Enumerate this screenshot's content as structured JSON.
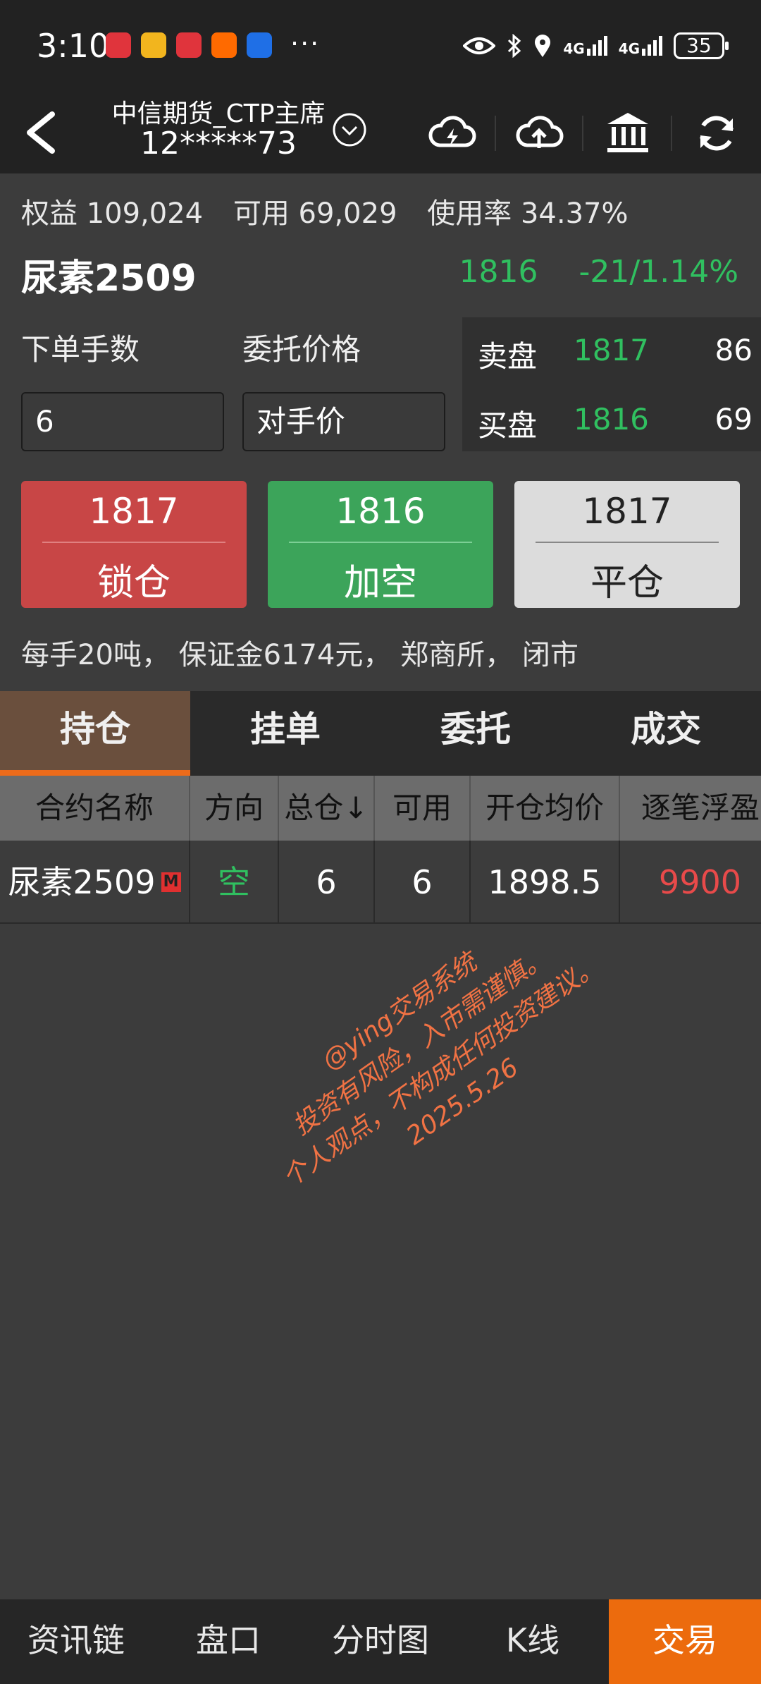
{
  "status_bar": {
    "time": "3:10",
    "apps": [
      "huawei-store-icon",
      "weibo-icon",
      "huawei-icon",
      "taobao-icon",
      "bulb-icon"
    ],
    "more": "···",
    "signal1": "4G",
    "signal2": "4G",
    "battery": "35"
  },
  "header": {
    "broker": "中信期货_CTP主席",
    "account": "12*****73",
    "icons": [
      "cloud-lightning-icon",
      "cloud-upload-icon",
      "bank-icon",
      "refresh-icon"
    ]
  },
  "account_summary": {
    "equity": "权益 109,024",
    "available": "可用 69,029",
    "usage": "使用率 34.37%"
  },
  "contract": {
    "name": "尿素2509",
    "last_price": "1816",
    "change": "-21/1.14%"
  },
  "order_form": {
    "lots_label": "下单手数",
    "price_label": "委托价格",
    "lots_value": "6",
    "price_value": "对手价"
  },
  "order_book": {
    "ask_label": "卖盘",
    "ask_price": "1817",
    "ask_volume": "86",
    "bid_label": "买盘",
    "bid_price": "1816",
    "bid_volume": "69"
  },
  "trade_buttons": {
    "lock": {
      "price": "1817",
      "label": "锁仓"
    },
    "add_short": {
      "price": "1816",
      "label": "加空"
    },
    "close": {
      "price": "1817",
      "label": "平仓"
    }
  },
  "contract_info": "每手20吨， 保证金6174元， 郑商所， 闭市",
  "tabs": [
    "持仓",
    "挂单",
    "委托",
    "成交"
  ],
  "positions": {
    "headers": [
      "合约名称",
      "方向",
      "总仓↓",
      "可用",
      "开仓均价",
      "逐笔浮盈"
    ],
    "rows": [
      {
        "name": "尿素2509",
        "badge": "M",
        "direction": "空",
        "total": "6",
        "available": "6",
        "avg_price": "1898.5",
        "pnl": "9900"
      }
    ]
  },
  "watermark": {
    "line1": "@ying交易系统",
    "line2": "投资有风险，入市需谨慎。",
    "line3": "个人观点，不构成任何投资建议。2025.5.26"
  },
  "bottom_nav": [
    "资讯链",
    "盘口",
    "分时图",
    "K线",
    "交易"
  ],
  "colors": {
    "up_red": "#c84646",
    "down_green": "#3ca45a",
    "accent_orange": "#ec6b0d",
    "quote_green": "#30c060",
    "pnl_red": "#e84a4a"
  }
}
